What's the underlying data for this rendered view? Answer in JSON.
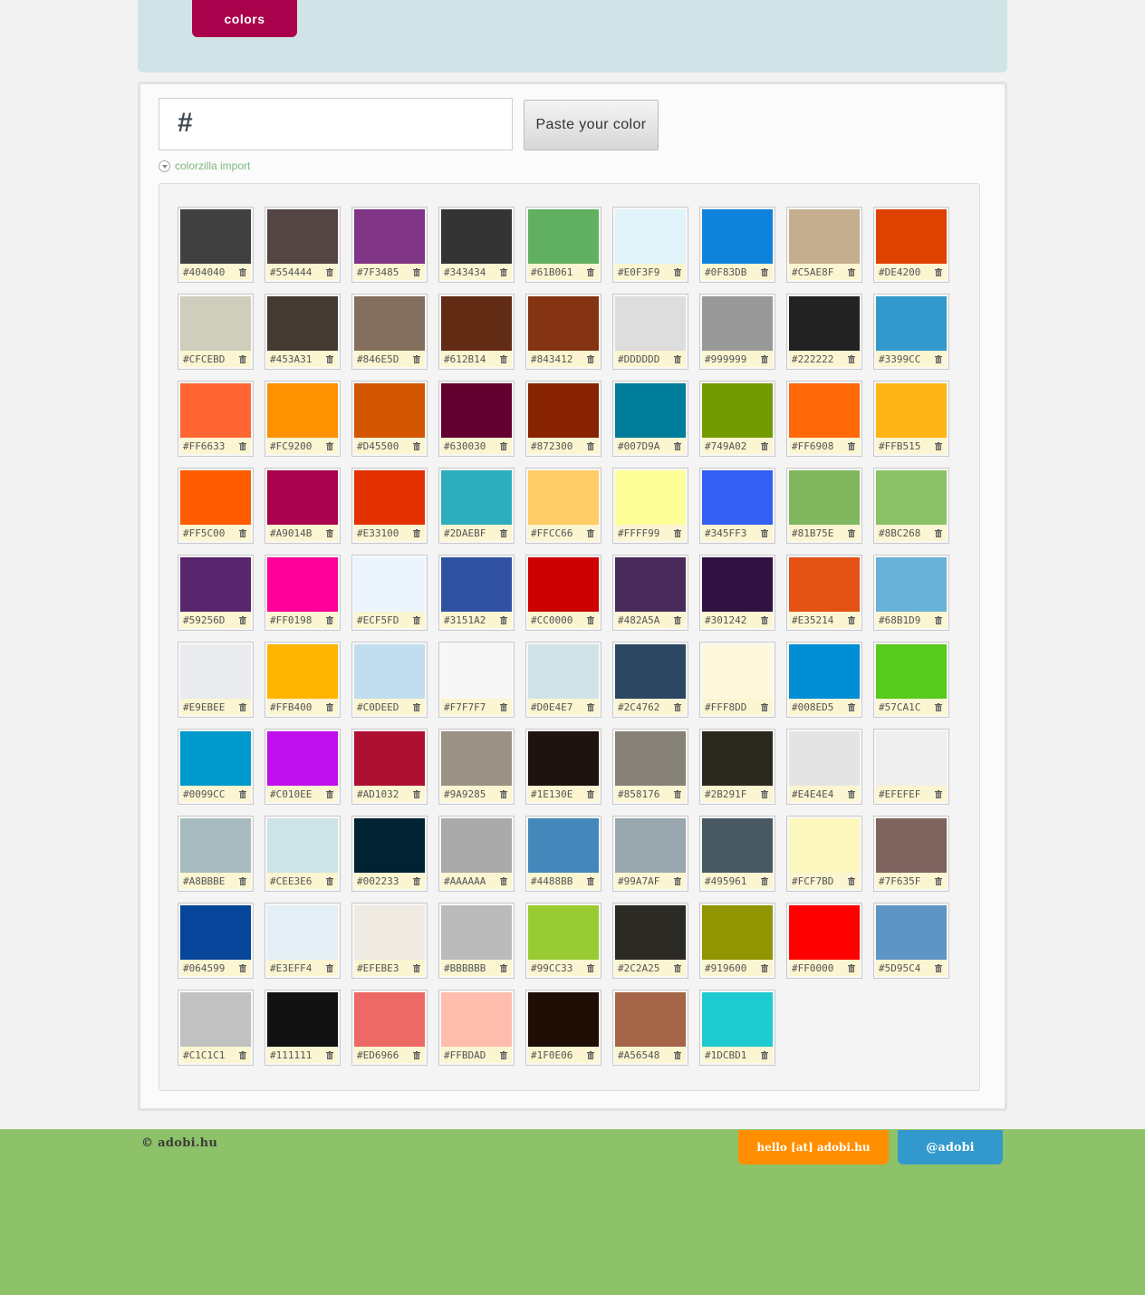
{
  "nav": {
    "tab_label": "colors"
  },
  "input": {
    "prefix": "#",
    "value": "",
    "paste_label": "Paste your color",
    "import_label": "colorzilla import"
  },
  "swatches": [
    "#404040",
    "#554444",
    "#7F3485",
    "#343434",
    "#61B061",
    "#E0F3F9",
    "#0F83DB",
    "#C5AE8F",
    "#DE4200",
    "#CFCEBD",
    "#453A31",
    "#846E5D",
    "#612B14",
    "#843412",
    "#DDDDDD",
    "#999999",
    "#222222",
    "#3399CC",
    "#FF6633",
    "#FC9200",
    "#D45500",
    "#630030",
    "#872300",
    "#007D9A",
    "#749A02",
    "#FF6908",
    "#FFB515",
    "#FF5C00",
    "#A9014B",
    "#E33100",
    "#2DAEBF",
    "#FFCC66",
    "#FFFF99",
    "#345FF3",
    "#81B75E",
    "#8BC268",
    "#59256D",
    "#FF0198",
    "#ECF5FD",
    "#3151A2",
    "#CC0000",
    "#482A5A",
    "#301242",
    "#E35214",
    "#68B1D9",
    "#E9EBEE",
    "#FFB400",
    "#C0DEED",
    "#F7F7F7",
    "#D0E4E7",
    "#2C4762",
    "#FFF8DD",
    "#008ED5",
    "#57CA1C",
    "#0099CC",
    "#C010EE",
    "#AD1032",
    "#9A9285",
    "#1E130E",
    "#858176",
    "#2B291F",
    "#E4E4E4",
    "#EFEFEF",
    "#A8BBBE",
    "#CEE3E6",
    "#002233",
    "#AAAAAA",
    "#4488BB",
    "#99A7AF",
    "#495961",
    "#FCF7BD",
    "#7F635F",
    "#064599",
    "#E3EFF4",
    "#EFEBE3",
    "#BBBBBB",
    "#99CC33",
    "#2C2A25",
    "#919600",
    "#FF0000",
    "#5D95C4",
    "#C1C1C1",
    "#111111",
    "#ED6966",
    "#FFBDAD",
    "#1F0E06",
    "#A56548",
    "#1DCBD1"
  ],
  "footer": {
    "copyright": "© adobi.hu",
    "email_label": "hello [at] adobi.hu",
    "twitter_label": "@adobi"
  },
  "colors": {
    "page_bg": "#f2f2f2",
    "header_band": "#d0e4e8",
    "nav_tab": "#a9014b",
    "footer_bg": "#8dc268",
    "email_button": "#ff8f00",
    "twitter_button": "#3399cc",
    "swatch_label_bg": "#fbf5d1"
  }
}
